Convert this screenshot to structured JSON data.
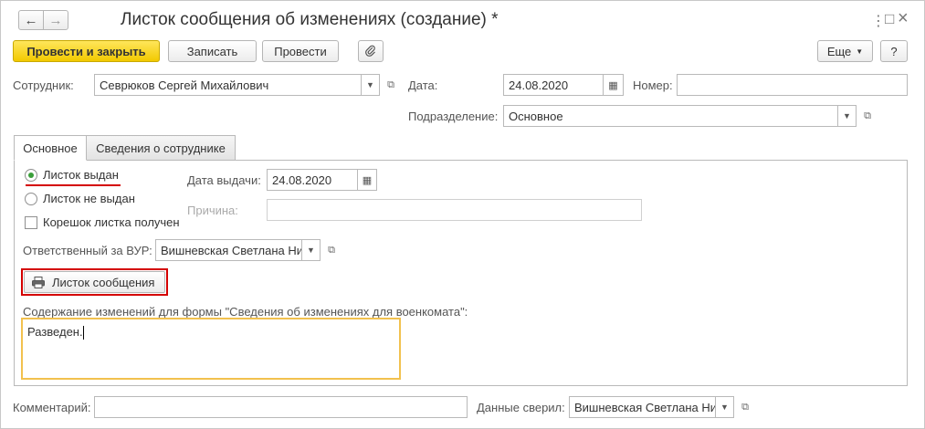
{
  "window": {
    "title": "Листок сообщения об изменениях (создание) *",
    "back_icon": "arrow-left-icon",
    "forward_icon": "arrow-right-icon",
    "more_icon": "⋮",
    "maximize_icon": "□",
    "close_icon": "×"
  },
  "toolbar": {
    "post_close_label": "Провести и закрыть",
    "save_label": "Записать",
    "post_label": "Провести",
    "attach_icon": "paperclip-icon",
    "more_label": "Еще",
    "help_label": "?"
  },
  "form": {
    "employee_label": "Сотрудник:",
    "employee_value": "Севрюков Сергей Михайлович",
    "date_label": "Дата:",
    "date_value": "24.08.2020",
    "number_label": "Номер:",
    "number_value": "",
    "department_label": "Подразделение:",
    "department_value": "Основное",
    "comment_label": "Комментарий:",
    "comment_value": "",
    "verified_label": "Данные сверил:",
    "verified_value": "Вишневская Светлана Ни"
  },
  "tabs": [
    {
      "label": "Основное",
      "active": true
    },
    {
      "label": "Сведения о сотруднике",
      "active": false
    }
  ],
  "main_tab": {
    "radio_issued": "Листок выдан",
    "radio_not_issued": "Листок не выдан",
    "radio_selected": "Листок выдан",
    "stub_received": "Корешок листка получен",
    "stub_received_checked": false,
    "issue_date_label": "Дата выдачи:",
    "issue_date_value": "24.08.2020",
    "reason_label": "Причина:",
    "reason_value": "",
    "responsible_label": "Ответственный за ВУР:",
    "responsible_value": "Вишневская Светлана Ни",
    "print_button_label": "Листок сообщения",
    "content_label": "Содержание изменений для формы \"Сведения об изменениях для военкомата\":",
    "content_value": "Разведен."
  },
  "colors": {
    "primary_button": "#f2c900",
    "highlight_red": "#d40000",
    "memo_border": "#f2c14e",
    "radio_dot": "#3a9f3a"
  }
}
